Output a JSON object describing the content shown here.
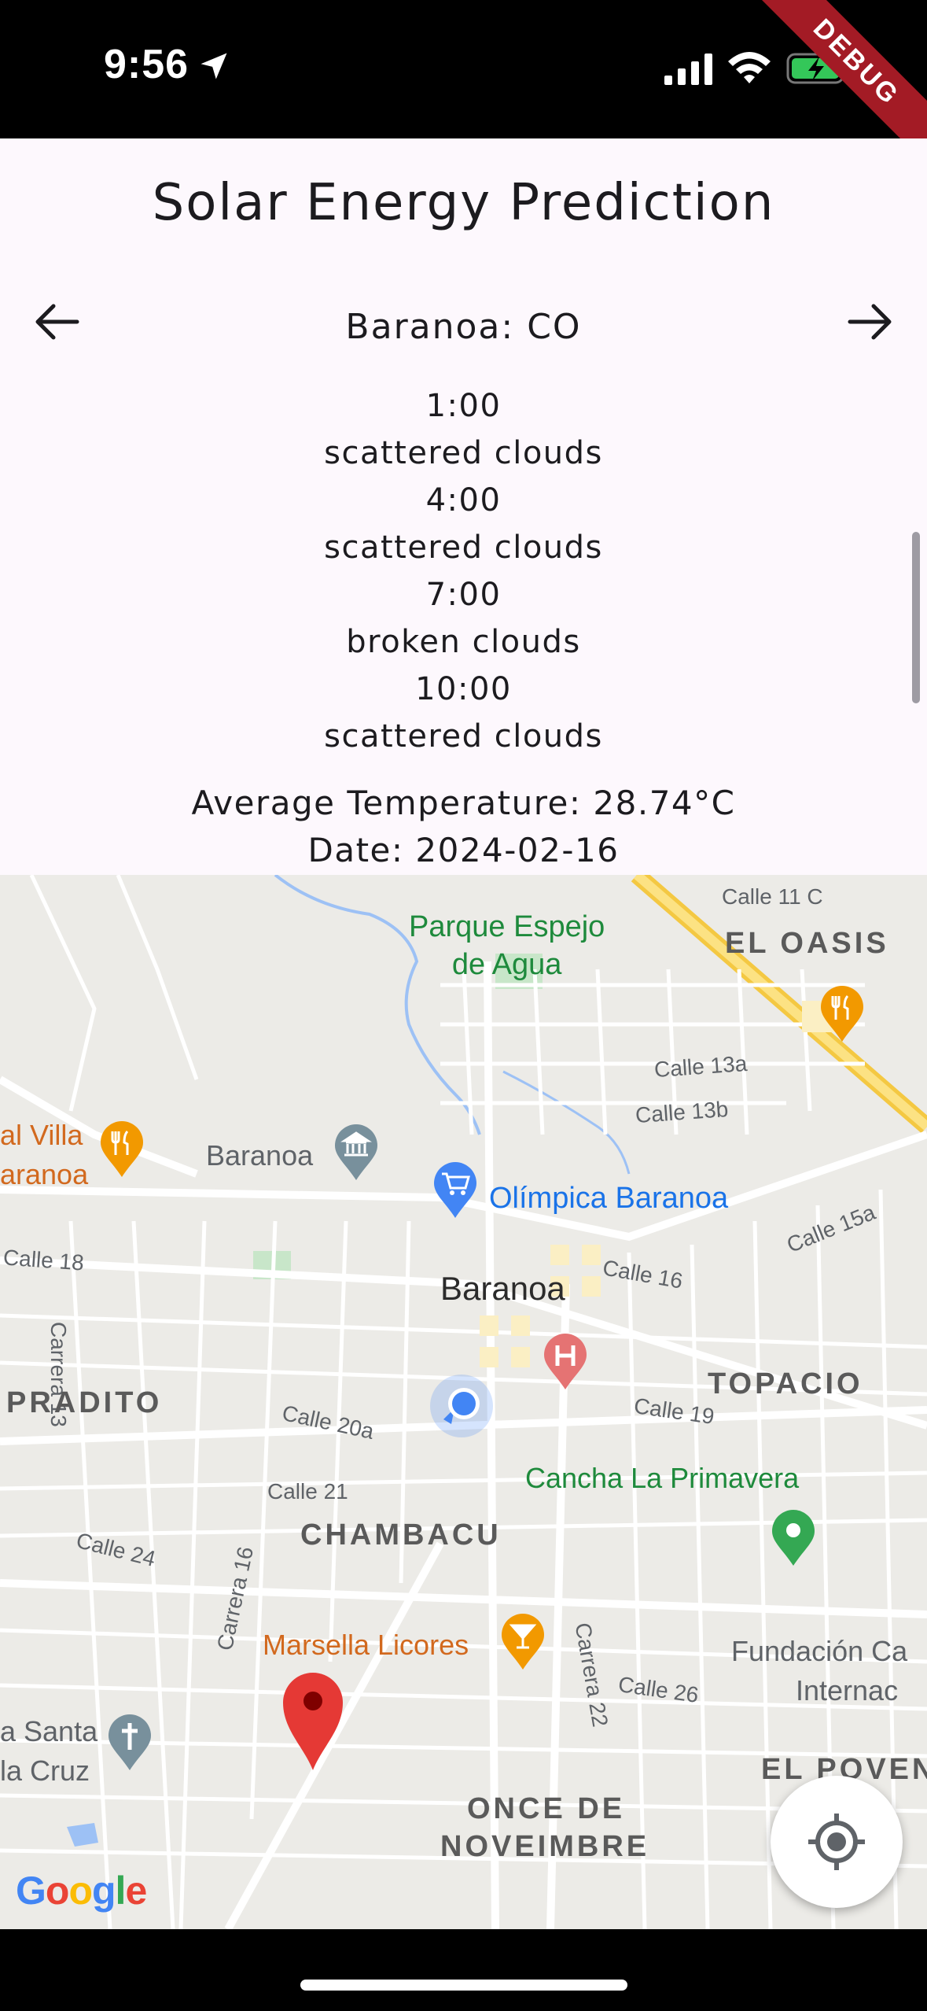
{
  "status_bar": {
    "time": "9:56",
    "debug_label": "DEBUG",
    "icons": [
      "location-arrow-icon",
      "signal-icon",
      "wifi-icon",
      "battery-charging-icon"
    ]
  },
  "header": {
    "title": "Solar Energy Prediction",
    "city": "Baranoa: CO"
  },
  "forecast": [
    {
      "time": "1:00",
      "condition": "scattered clouds"
    },
    {
      "time": "4:00",
      "condition": "scattered clouds"
    },
    {
      "time": "7:00",
      "condition": "broken clouds"
    },
    {
      "time": "10:00",
      "condition": "scattered clouds"
    }
  ],
  "summary": {
    "avg_temperature": "Average Temperature: 28.74°C",
    "date": "Date: 2024-02-16"
  },
  "map": {
    "labels": {
      "park": "Parque Espejo\nde Agua",
      "el_oasis": "EL OASIS",
      "calle_11c": "Calle 11 C",
      "calle_13a": "Calle 13a",
      "calle_13b": "Calle 13b",
      "calle_15a": "Calle 15a",
      "calle_16": "Calle 16",
      "calle_18": "Calle 18",
      "carrera_13": "Carrera 13",
      "calle_19": "Calle 19",
      "calle_20a": "Calle 20a",
      "calle_21": "Calle 21",
      "calle_24": "Calle 24",
      "carrera_16": "Carrera 16",
      "carrera_22": "Carrera 22",
      "calle_26": "Calle 26",
      "villa": "al Villa",
      "villa2": "aranoa",
      "baranoa_museum": "Baranoa",
      "olimpica": "Olímpica Baranoa",
      "city": "Baranoa",
      "pradito": "PRADITO",
      "topacio": "TOPACIO",
      "cancha": "Cancha La Primavera",
      "chambacu": "CHAMBACU",
      "marsella": "Marsella Licores",
      "fundacion1": "Fundación Ca",
      "fundacion2": "Internac",
      "santa1": "a Santa",
      "santa2": "la Cruz",
      "el_poven": "EL POVEN",
      "once1": "ONCE DE",
      "once2": "NOVEIMBRE",
      "google": "Google"
    }
  },
  "colors": {
    "panel_bg": "#fdf8fd",
    "map_bg": "#ecebe7",
    "pin_red": "#e53935",
    "user_blue": "#4285f4",
    "poi_orange": "#f29900",
    "poi_green": "#34a853"
  }
}
